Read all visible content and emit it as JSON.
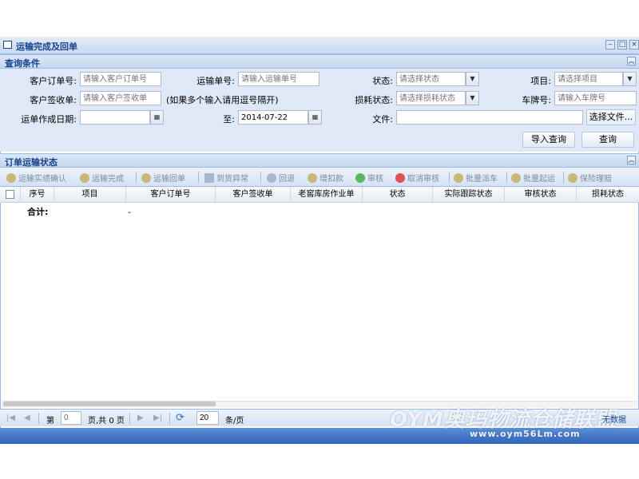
{
  "window": {
    "title": "运输完成及回单",
    "buttons": {
      "minimize": "‒",
      "maximize": "□",
      "close": "×"
    }
  },
  "query_section": {
    "title": "查询条件",
    "fields": {
      "customer_order_label": "客户订单号:",
      "customer_order_placeholder": "请输入客户订单号",
      "transport_no_label": "运输单号:",
      "transport_no_placeholder": "请输入运输单号",
      "status_label": "状态:",
      "status_placeholder": "请选择状态",
      "project_label": "项目:",
      "project_placeholder": "请选择项目",
      "customer_receipt_label": "客户签收单:",
      "customer_receipt_placeholder": "请输入客户签收单",
      "multi_input_note": "(如果多个输入请用逗号隔开)",
      "loss_status_label": "损耗状态:",
      "loss_status_placeholder": "请选择损耗状态",
      "plate_label": "车牌号:",
      "plate_placeholder": "请输入车牌号",
      "date_label": "运单作成日期:",
      "date_from_value": "",
      "to_label": "至:",
      "date_to_value": "2014-07-22",
      "file_label": "文件:",
      "file_value": ""
    },
    "buttons": {
      "choose_file": "选择文件...",
      "import_query": "导入查询",
      "query": "查询"
    }
  },
  "order_section": {
    "title": "订单运输状态",
    "toolbar": [
      {
        "label": "运输实绩确认",
        "icon": "gear-icon",
        "color": "#c8b878"
      },
      {
        "label": "运输完成",
        "icon": "gear-icon",
        "color": "#c8b878"
      },
      {
        "label": "运输回单",
        "icon": "gear-icon",
        "color": "#c8b878"
      },
      {
        "label": "到货异常",
        "icon": "list-icon",
        "color": "#a9b8cf"
      },
      {
        "label": "回退",
        "icon": "back-icon",
        "color": "#a9b8cf"
      },
      {
        "label": "增扣款",
        "icon": "gear-icon",
        "color": "#c8b878"
      },
      {
        "label": "审核",
        "icon": "check-icon",
        "color": "#5cb85c"
      },
      {
        "label": "取消审核",
        "icon": "x-icon",
        "color": "#e05050"
      },
      {
        "label": "批量派车",
        "icon": "gear-icon",
        "color": "#c8b878"
      },
      {
        "label": "批量起运",
        "icon": "gear-icon",
        "color": "#c8b878"
      },
      {
        "label": "保险理赔",
        "icon": "gear-icon",
        "color": "#c8b878"
      }
    ],
    "columns": [
      "序号",
      "项目",
      "客户订单号",
      "客户签收单",
      "老窖库房作业单",
      "状态",
      "实际跟踪状态",
      "审核状态",
      "损耗状态"
    ],
    "summary_label": "合计:",
    "summary_value": "-"
  },
  "pager": {
    "page_label": "第",
    "page_value": "0",
    "total_label": "页,共 0 页",
    "page_size": "20",
    "per_page_label": "条/页",
    "no_data": "无数据"
  },
  "watermark": {
    "brand": "OYM奥玛物流仓储联盟",
    "url": "www.oym56Lm.com"
  },
  "colors": {
    "header_text": "#15428b",
    "panel_bg": "#dfe8f6",
    "border": "#99bbe8",
    "bottom_bar": "#2f64b8"
  }
}
